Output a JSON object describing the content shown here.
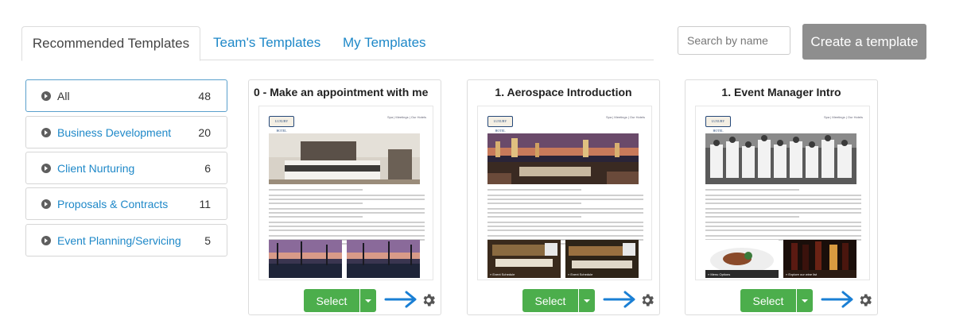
{
  "tabs": [
    {
      "label": "Recommended Templates"
    },
    {
      "label": "Team's Templates"
    },
    {
      "label": "My Templates"
    }
  ],
  "search": {
    "placeholder": "Search by name"
  },
  "create_button": {
    "label": "Create a template"
  },
  "categories": [
    {
      "label": "All",
      "count": "48"
    },
    {
      "label": "Business Development",
      "count": "20"
    },
    {
      "label": "Client Nurturing",
      "count": "6"
    },
    {
      "label": "Proposals & Contracts",
      "count": "11"
    },
    {
      "label": "Event Planning/Servicing",
      "count": "5"
    }
  ],
  "cards": [
    {
      "title": "0 - Make an appointment with me",
      "select_label": "Select",
      "logo": "LUXURY HOTEL",
      "links": "Spa | Meetings | Our Hotels",
      "caption_a": "",
      "caption_b": ""
    },
    {
      "title": "1. Aerospace Introduction",
      "select_label": "Select",
      "logo": "LUXURY HOTEL",
      "links": "Spa | Meetings | Our Hotels",
      "caption_a": "» Event Schedule",
      "caption_b": "» Event Schedule"
    },
    {
      "title": "1. Event Manager Intro",
      "select_label": "Select",
      "logo": "LUXURY HOTEL",
      "links": "Spa | Meetings | Our Hotels",
      "caption_a": "» Menu Options",
      "caption_b": "» Explore our wine list"
    }
  ],
  "colors": {
    "accent": "#1e88c8",
    "select_green": "#4cae4c",
    "create_gray": "#8e8e8e",
    "arrow_blue": "#1a7fd4"
  },
  "icons": {
    "category_bullet": "chevron-circle-right-icon",
    "settings": "gear-icon",
    "pointer": "arrow-right-icon"
  }
}
